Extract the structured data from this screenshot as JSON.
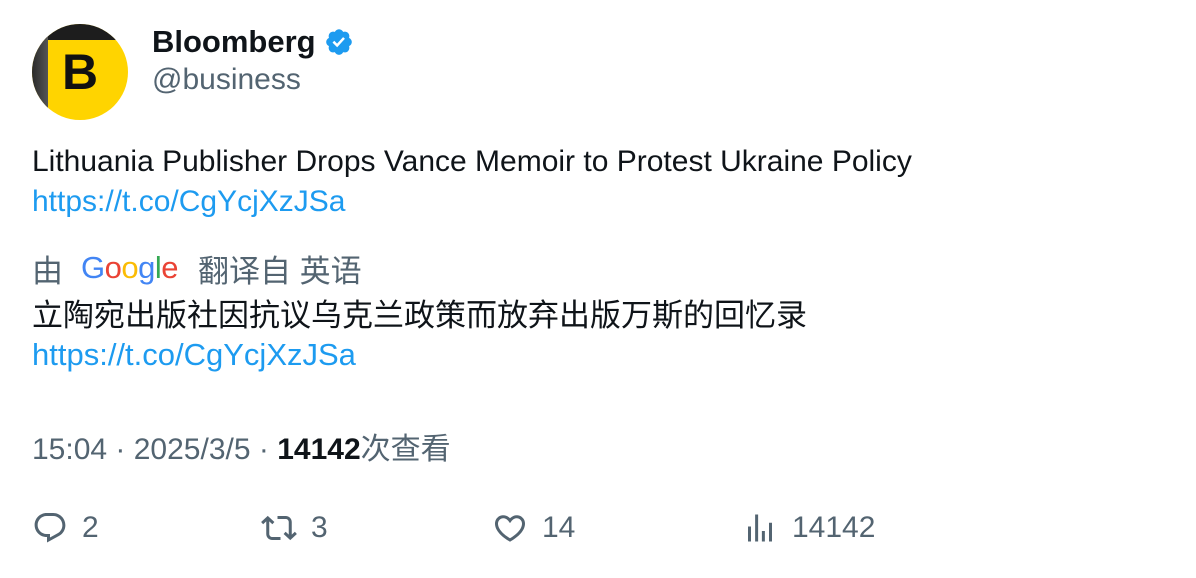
{
  "author": {
    "avatar_letter": "B",
    "display_name": "Bloomberg",
    "handle": "@business",
    "verified_color": "#1d9bf0"
  },
  "tweet": {
    "text": "Lithuania Publisher Drops Vance Memoir to Protest Ukraine Policy",
    "link": "https://t.co/CgYcjXzJSa"
  },
  "translation": {
    "prefix": "由",
    "provider": "Google",
    "suffix": "翻译自 英语",
    "text": "立陶宛出版社因抗议乌克兰政策而放弃出版万斯的回忆录",
    "link": "https://t.co/CgYcjXzJSa"
  },
  "meta": {
    "time": "15:04",
    "separator1": " · ",
    "date": "2025/3/5",
    "separator2": " · ",
    "views": "14142",
    "views_label": "次查看"
  },
  "actions": {
    "replies": "2",
    "reposts": "3",
    "likes": "14",
    "views": "14142"
  },
  "colors": {
    "link": "#1d9bf0",
    "secondary": "#536471",
    "primary": "#0f1419",
    "avatar_bg": "#ffd400"
  }
}
